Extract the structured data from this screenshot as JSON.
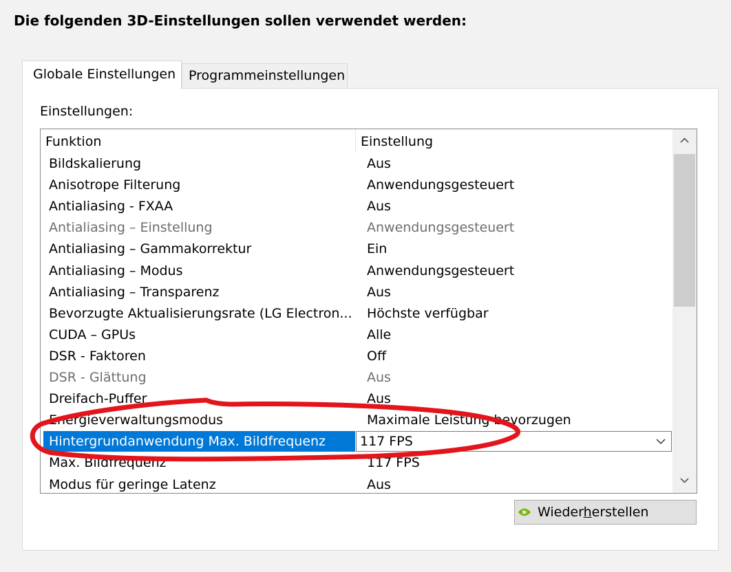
{
  "heading": "Die folgenden 3D-Einstellungen sollen verwendet werden:",
  "tabs": [
    {
      "label": "Globale Einstellungen",
      "active": true
    },
    {
      "label": "Programmeinstellungen",
      "active": false
    }
  ],
  "panel_label": "Einstellungen:",
  "list": {
    "columns": [
      "Funktion",
      "Einstellung"
    ],
    "rows": [
      {
        "feature": "Bildskalierung",
        "setting": "Aus",
        "disabled": false
      },
      {
        "feature": "Anisotrope Filterung",
        "setting": "Anwendungsgesteuert",
        "disabled": false
      },
      {
        "feature": "Antialiasing - FXAA",
        "setting": "Aus",
        "disabled": false
      },
      {
        "feature": "Antialiasing – Einstellung",
        "setting": "Anwendungsgesteuert",
        "disabled": true
      },
      {
        "feature": "Antialiasing – Gammakorrektur",
        "setting": "Ein",
        "disabled": false
      },
      {
        "feature": "Antialiasing – Modus",
        "setting": "Anwendungsgesteuert",
        "disabled": false
      },
      {
        "feature": "Antialiasing – Transparenz",
        "setting": "Aus",
        "disabled": false
      },
      {
        "feature": "Bevorzugte Aktualisierungsrate (LG Electron...",
        "setting": "Höchste verfügbar",
        "disabled": false
      },
      {
        "feature": "CUDA – GPUs",
        "setting": "Alle",
        "disabled": false
      },
      {
        "feature": "DSR - Faktoren",
        "setting": "Off",
        "disabled": false
      },
      {
        "feature": "DSR - Glättung",
        "setting": "Aus",
        "disabled": true
      },
      {
        "feature": "Dreifach-Puffer",
        "setting": "Aus",
        "disabled": false
      },
      {
        "feature": "Energieverwaltungsmodus",
        "setting": "Maximale Leistung bevorzugen",
        "disabled": false
      },
      {
        "feature": "Hintergrundanwendung Max. Bildfrequenz",
        "setting": "117 FPS",
        "disabled": false,
        "selected": true
      },
      {
        "feature": "Max. Bildfrequenz",
        "setting": "117 FPS",
        "disabled": false
      },
      {
        "feature": "Modus für geringe Latenz",
        "setting": "Aus",
        "disabled": false
      }
    ]
  },
  "restore_button": {
    "label_before": "Wieder",
    "label_mnemonic": "h",
    "label_after": "erstellen"
  },
  "icons": {
    "dropdown": "chevron-down-icon",
    "scroll_up": "scroll-up-arrow-icon",
    "scroll_down": "scroll-down-arrow-icon",
    "button_logo": "nvidia-logo-icon"
  },
  "colors": {
    "selection": "#0078d7",
    "annotation": "#e3151c",
    "disabled_text": "#6d6d6d",
    "nvidia_green": "#76b900"
  }
}
